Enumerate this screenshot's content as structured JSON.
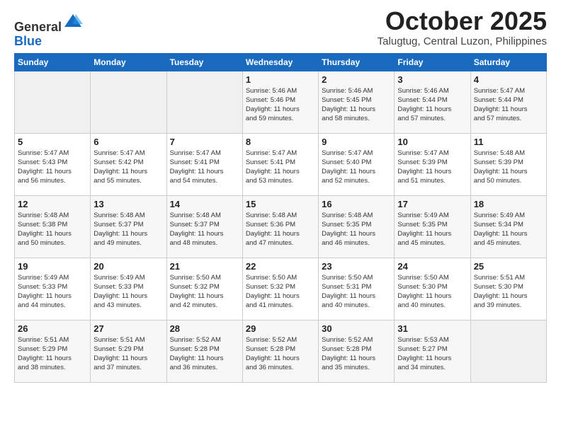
{
  "header": {
    "logo_line1": "General",
    "logo_line2": "Blue",
    "month_title": "October 2025",
    "location": "Talugtug, Central Luzon, Philippines"
  },
  "weekdays": [
    "Sunday",
    "Monday",
    "Tuesday",
    "Wednesday",
    "Thursday",
    "Friday",
    "Saturday"
  ],
  "weeks": [
    [
      {
        "day": "",
        "info": ""
      },
      {
        "day": "",
        "info": ""
      },
      {
        "day": "",
        "info": ""
      },
      {
        "day": "1",
        "info": "Sunrise: 5:46 AM\nSunset: 5:46 PM\nDaylight: 11 hours\nand 59 minutes."
      },
      {
        "day": "2",
        "info": "Sunrise: 5:46 AM\nSunset: 5:45 PM\nDaylight: 11 hours\nand 58 minutes."
      },
      {
        "day": "3",
        "info": "Sunrise: 5:46 AM\nSunset: 5:44 PM\nDaylight: 11 hours\nand 57 minutes."
      },
      {
        "day": "4",
        "info": "Sunrise: 5:47 AM\nSunset: 5:44 PM\nDaylight: 11 hours\nand 57 minutes."
      }
    ],
    [
      {
        "day": "5",
        "info": "Sunrise: 5:47 AM\nSunset: 5:43 PM\nDaylight: 11 hours\nand 56 minutes."
      },
      {
        "day": "6",
        "info": "Sunrise: 5:47 AM\nSunset: 5:42 PM\nDaylight: 11 hours\nand 55 minutes."
      },
      {
        "day": "7",
        "info": "Sunrise: 5:47 AM\nSunset: 5:41 PM\nDaylight: 11 hours\nand 54 minutes."
      },
      {
        "day": "8",
        "info": "Sunrise: 5:47 AM\nSunset: 5:41 PM\nDaylight: 11 hours\nand 53 minutes."
      },
      {
        "day": "9",
        "info": "Sunrise: 5:47 AM\nSunset: 5:40 PM\nDaylight: 11 hours\nand 52 minutes."
      },
      {
        "day": "10",
        "info": "Sunrise: 5:47 AM\nSunset: 5:39 PM\nDaylight: 11 hours\nand 51 minutes."
      },
      {
        "day": "11",
        "info": "Sunrise: 5:48 AM\nSunset: 5:39 PM\nDaylight: 11 hours\nand 50 minutes."
      }
    ],
    [
      {
        "day": "12",
        "info": "Sunrise: 5:48 AM\nSunset: 5:38 PM\nDaylight: 11 hours\nand 50 minutes."
      },
      {
        "day": "13",
        "info": "Sunrise: 5:48 AM\nSunset: 5:37 PM\nDaylight: 11 hours\nand 49 minutes."
      },
      {
        "day": "14",
        "info": "Sunrise: 5:48 AM\nSunset: 5:37 PM\nDaylight: 11 hours\nand 48 minutes."
      },
      {
        "day": "15",
        "info": "Sunrise: 5:48 AM\nSunset: 5:36 PM\nDaylight: 11 hours\nand 47 minutes."
      },
      {
        "day": "16",
        "info": "Sunrise: 5:48 AM\nSunset: 5:35 PM\nDaylight: 11 hours\nand 46 minutes."
      },
      {
        "day": "17",
        "info": "Sunrise: 5:49 AM\nSunset: 5:35 PM\nDaylight: 11 hours\nand 45 minutes."
      },
      {
        "day": "18",
        "info": "Sunrise: 5:49 AM\nSunset: 5:34 PM\nDaylight: 11 hours\nand 45 minutes."
      }
    ],
    [
      {
        "day": "19",
        "info": "Sunrise: 5:49 AM\nSunset: 5:33 PM\nDaylight: 11 hours\nand 44 minutes."
      },
      {
        "day": "20",
        "info": "Sunrise: 5:49 AM\nSunset: 5:33 PM\nDaylight: 11 hours\nand 43 minutes."
      },
      {
        "day": "21",
        "info": "Sunrise: 5:50 AM\nSunset: 5:32 PM\nDaylight: 11 hours\nand 42 minutes."
      },
      {
        "day": "22",
        "info": "Sunrise: 5:50 AM\nSunset: 5:32 PM\nDaylight: 11 hours\nand 41 minutes."
      },
      {
        "day": "23",
        "info": "Sunrise: 5:50 AM\nSunset: 5:31 PM\nDaylight: 11 hours\nand 40 minutes."
      },
      {
        "day": "24",
        "info": "Sunrise: 5:50 AM\nSunset: 5:30 PM\nDaylight: 11 hours\nand 40 minutes."
      },
      {
        "day": "25",
        "info": "Sunrise: 5:51 AM\nSunset: 5:30 PM\nDaylight: 11 hours\nand 39 minutes."
      }
    ],
    [
      {
        "day": "26",
        "info": "Sunrise: 5:51 AM\nSunset: 5:29 PM\nDaylight: 11 hours\nand 38 minutes."
      },
      {
        "day": "27",
        "info": "Sunrise: 5:51 AM\nSunset: 5:29 PM\nDaylight: 11 hours\nand 37 minutes."
      },
      {
        "day": "28",
        "info": "Sunrise: 5:52 AM\nSunset: 5:28 PM\nDaylight: 11 hours\nand 36 minutes."
      },
      {
        "day": "29",
        "info": "Sunrise: 5:52 AM\nSunset: 5:28 PM\nDaylight: 11 hours\nand 36 minutes."
      },
      {
        "day": "30",
        "info": "Sunrise: 5:52 AM\nSunset: 5:28 PM\nDaylight: 11 hours\nand 35 minutes."
      },
      {
        "day": "31",
        "info": "Sunrise: 5:53 AM\nSunset: 5:27 PM\nDaylight: 11 hours\nand 34 minutes."
      },
      {
        "day": "",
        "info": ""
      }
    ]
  ]
}
